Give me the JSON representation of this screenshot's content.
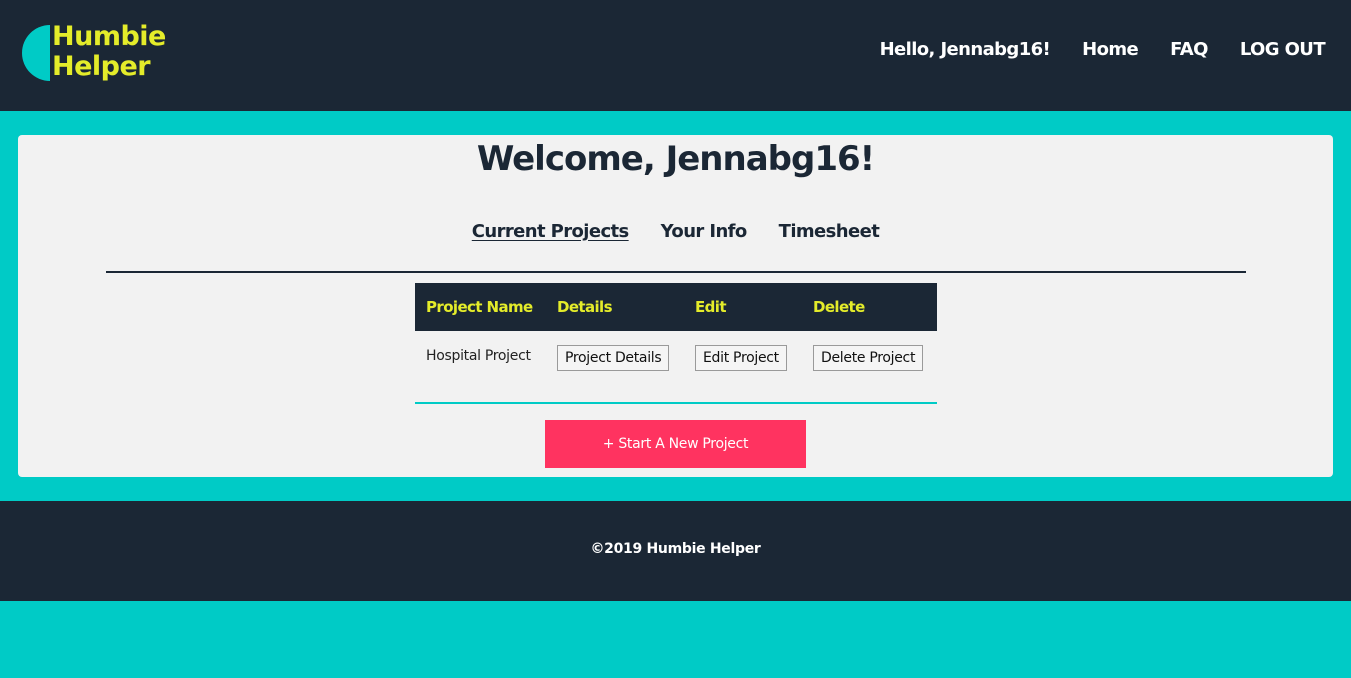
{
  "brand": {
    "line1": "Humbie",
    "line2": "Helper",
    "logo_color": "#e4ec2a",
    "accent": "#00cbc6"
  },
  "nav": {
    "greeting": "Hello, Jennabg16!",
    "home": "Home",
    "faq": "FAQ",
    "logout": "LOG OUT"
  },
  "main": {
    "welcome": "Welcome, Jennabg16!",
    "tabs": [
      {
        "label": "Current Projects",
        "active": true
      },
      {
        "label": "Your Info",
        "active": false
      },
      {
        "label": "Timesheet",
        "active": false
      }
    ],
    "table": {
      "headers": [
        "Project Name",
        "Details",
        "Edit",
        "Delete"
      ],
      "rows": [
        {
          "name": "Hospital Project",
          "details_button": "Project Details",
          "edit_button": "Edit Project",
          "delete_button": "Delete Project"
        }
      ]
    },
    "start_button": "+ Start A New Project"
  },
  "footer": {
    "copyright": "©2019 Humbie Helper"
  },
  "colors": {
    "dark": "#1b2735",
    "teal": "#00cbc6",
    "yellow": "#e4ec2a",
    "cta": "#ff3360",
    "card": "#f2f2f2"
  }
}
